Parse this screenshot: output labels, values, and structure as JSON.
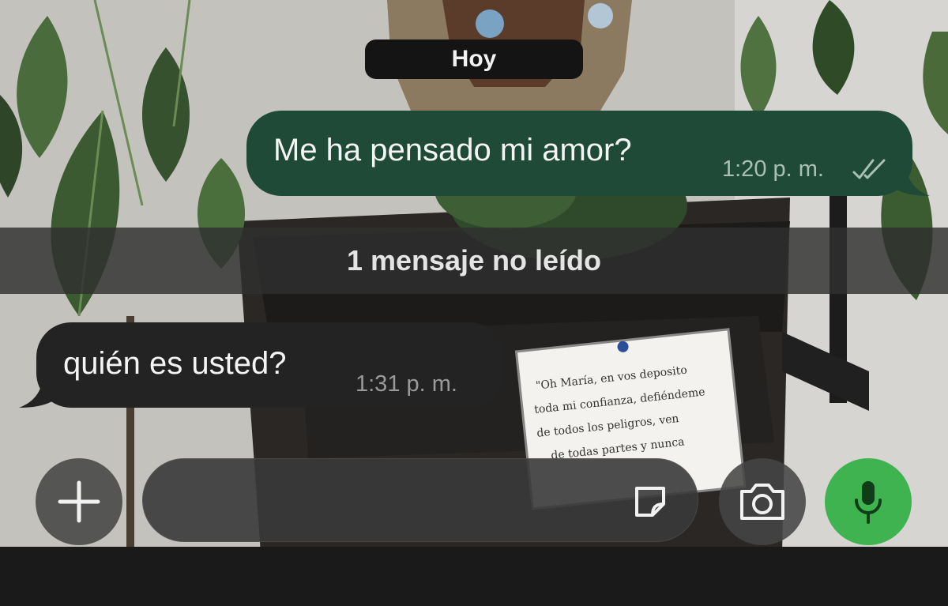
{
  "chat": {
    "date_label": "Hoy",
    "unread_banner": "1 mensaje no leído",
    "messages": [
      {
        "direction": "outgoing",
        "text": "Me ha pensado mi amor?",
        "time": "1:20 p. m.",
        "status": "read"
      },
      {
        "direction": "incoming",
        "text": "quién es usted?",
        "time": "1:31 p. m."
      }
    ]
  },
  "composer": {
    "placeholder": "",
    "icons": {
      "attach": "plus-icon",
      "sticker": "sticker-icon",
      "camera": "camera-icon",
      "voice": "microphone-icon"
    }
  },
  "wallpaper": {
    "note_text": "\"Oh María, en vos deposito toda mi confianza, defiéndeme de todos los peligros, ven de todas partes y nunca"
  },
  "colors": {
    "outgoing_bubble": "#1e4a37",
    "incoming_bubble": "#232323",
    "mic_button": "#3fb34f",
    "read_check": "#a9c1b4"
  }
}
